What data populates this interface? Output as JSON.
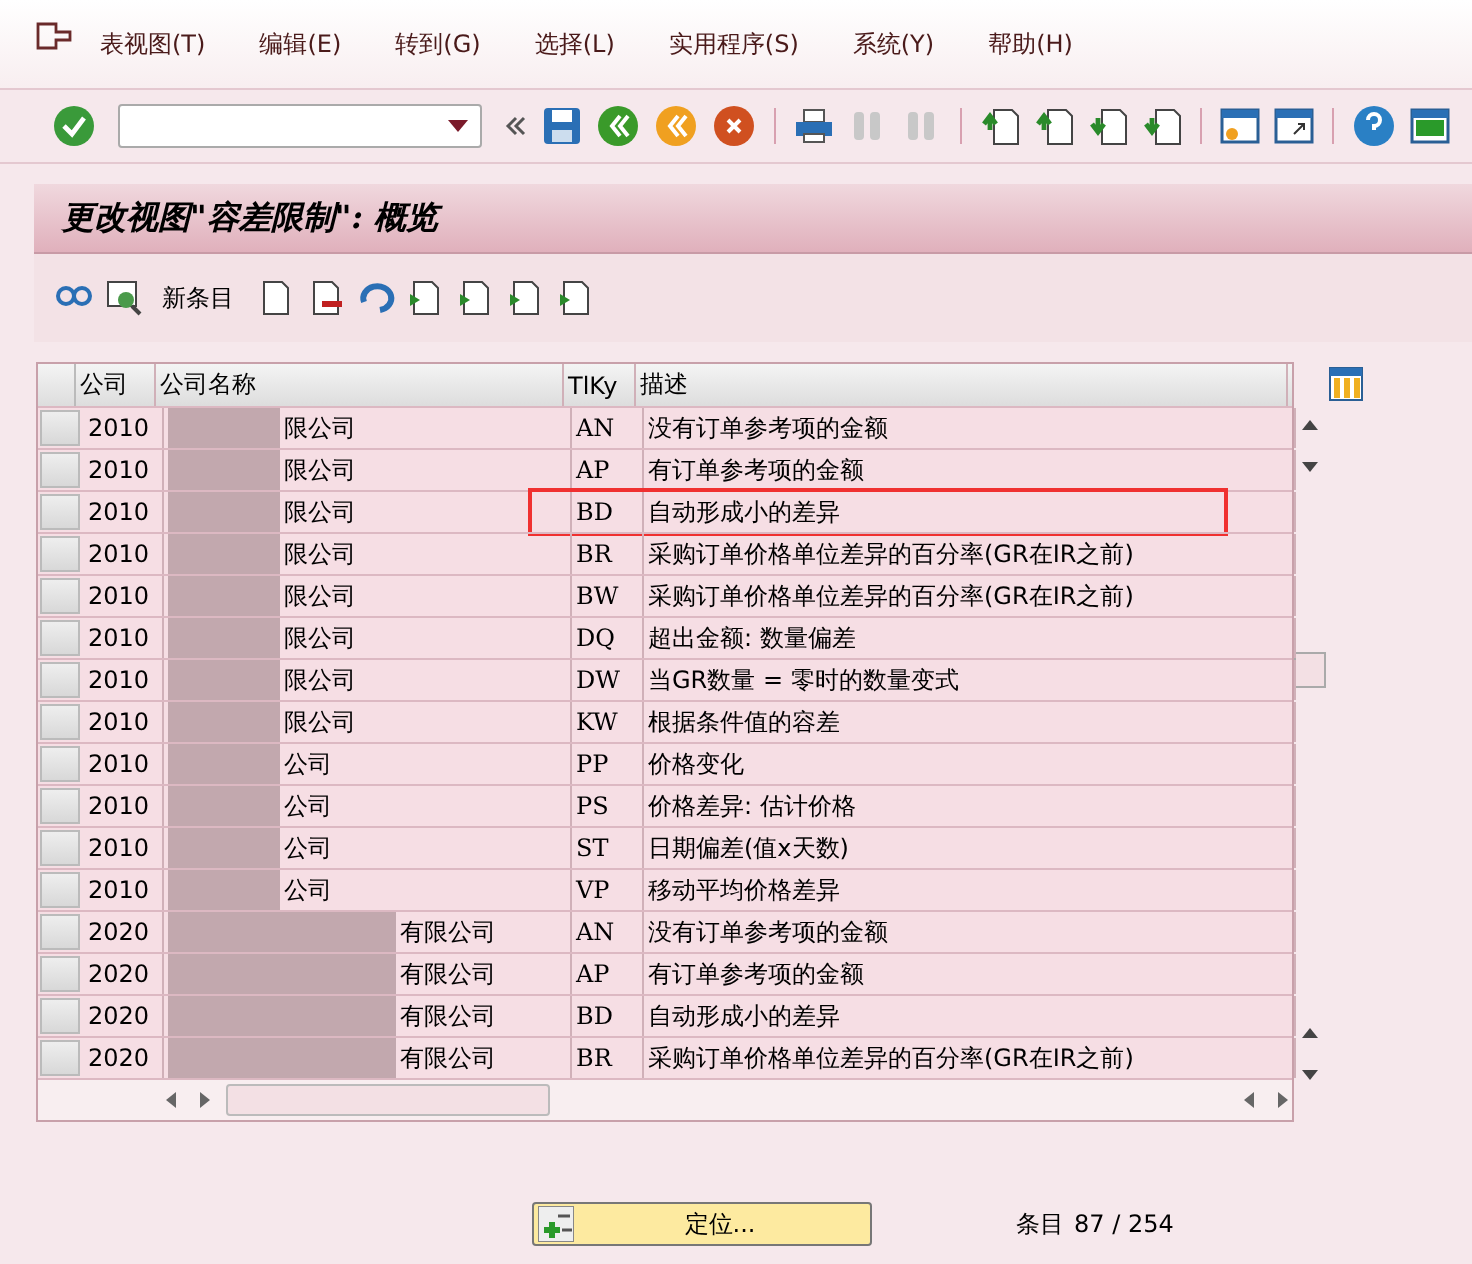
{
  "menu": [
    "表视图(T)",
    "编辑(E)",
    "转到(G)",
    "选择(L)",
    "实用程序(S)",
    "系统(Y)",
    "帮助(H)"
  ],
  "title": "更改视图\"容差限制\": 概览",
  "app_toolbar": {
    "new_entries": "新条目"
  },
  "table": {
    "columns": [
      "公司",
      "公司名称",
      "TlKy",
      "描述"
    ],
    "rows": [
      {
        "code": "2010",
        "name": "限公司",
        "key": "AN",
        "desc": "没有订单参考项的金额",
        "highlighted": false
      },
      {
        "code": "2010",
        "name": "限公司",
        "key": "AP",
        "desc": "有订单参考项的金额",
        "highlighted": false
      },
      {
        "code": "2010",
        "name": "限公司",
        "key": "BD",
        "desc": "自动形成小的差异",
        "highlighted": true
      },
      {
        "code": "2010",
        "name": "限公司",
        "key": "BR",
        "desc": "采购订单价格单位差异的百分率(GR在IR之前)",
        "highlighted": false
      },
      {
        "code": "2010",
        "name": "限公司",
        "key": "BW",
        "desc": "采购订单价格单位差异的百分率(GR在IR之前)",
        "highlighted": false
      },
      {
        "code": "2010",
        "name": "限公司",
        "key": "DQ",
        "desc": "超出金额: 数量偏差",
        "highlighted": false
      },
      {
        "code": "2010",
        "name": "限公司",
        "key": "DW",
        "desc": "当GR数量 = 零时的数量变式",
        "highlighted": false
      },
      {
        "code": "2010",
        "name": "限公司",
        "key": "KW",
        "desc": "根据条件值的容差",
        "highlighted": false
      },
      {
        "code": "2010",
        "name": "公司",
        "key": "PP",
        "desc": "价格变化",
        "highlighted": false
      },
      {
        "code": "2010",
        "name": "公司",
        "key": "PS",
        "desc": "价格差异: 估计价格",
        "highlighted": false
      },
      {
        "code": "2010",
        "name": "公司",
        "key": "ST",
        "desc": "日期偏差(值x天数)",
        "highlighted": false
      },
      {
        "code": "2010",
        "name": "公司",
        "key": "VP",
        "desc": "移动平均价格差异",
        "highlighted": false
      },
      {
        "code": "2020",
        "name": "有限公司",
        "key": "AN",
        "desc": "没有订单参考项的金额",
        "highlighted": false
      },
      {
        "code": "2020",
        "name": "有限公司",
        "key": "AP",
        "desc": "有订单参考项的金额",
        "highlighted": false
      },
      {
        "code": "2020",
        "name": "有限公司",
        "key": "BD",
        "desc": "自动形成小的差异",
        "highlighted": false
      },
      {
        "code": "2020",
        "name": "有限公司",
        "key": "BR",
        "desc": "采购订单价格单位差异的百分率(GR在IR之前)",
        "highlighted": false
      }
    ]
  },
  "position_button": "定位...",
  "entry_label": "条目",
  "entry_count": "87 / 254"
}
